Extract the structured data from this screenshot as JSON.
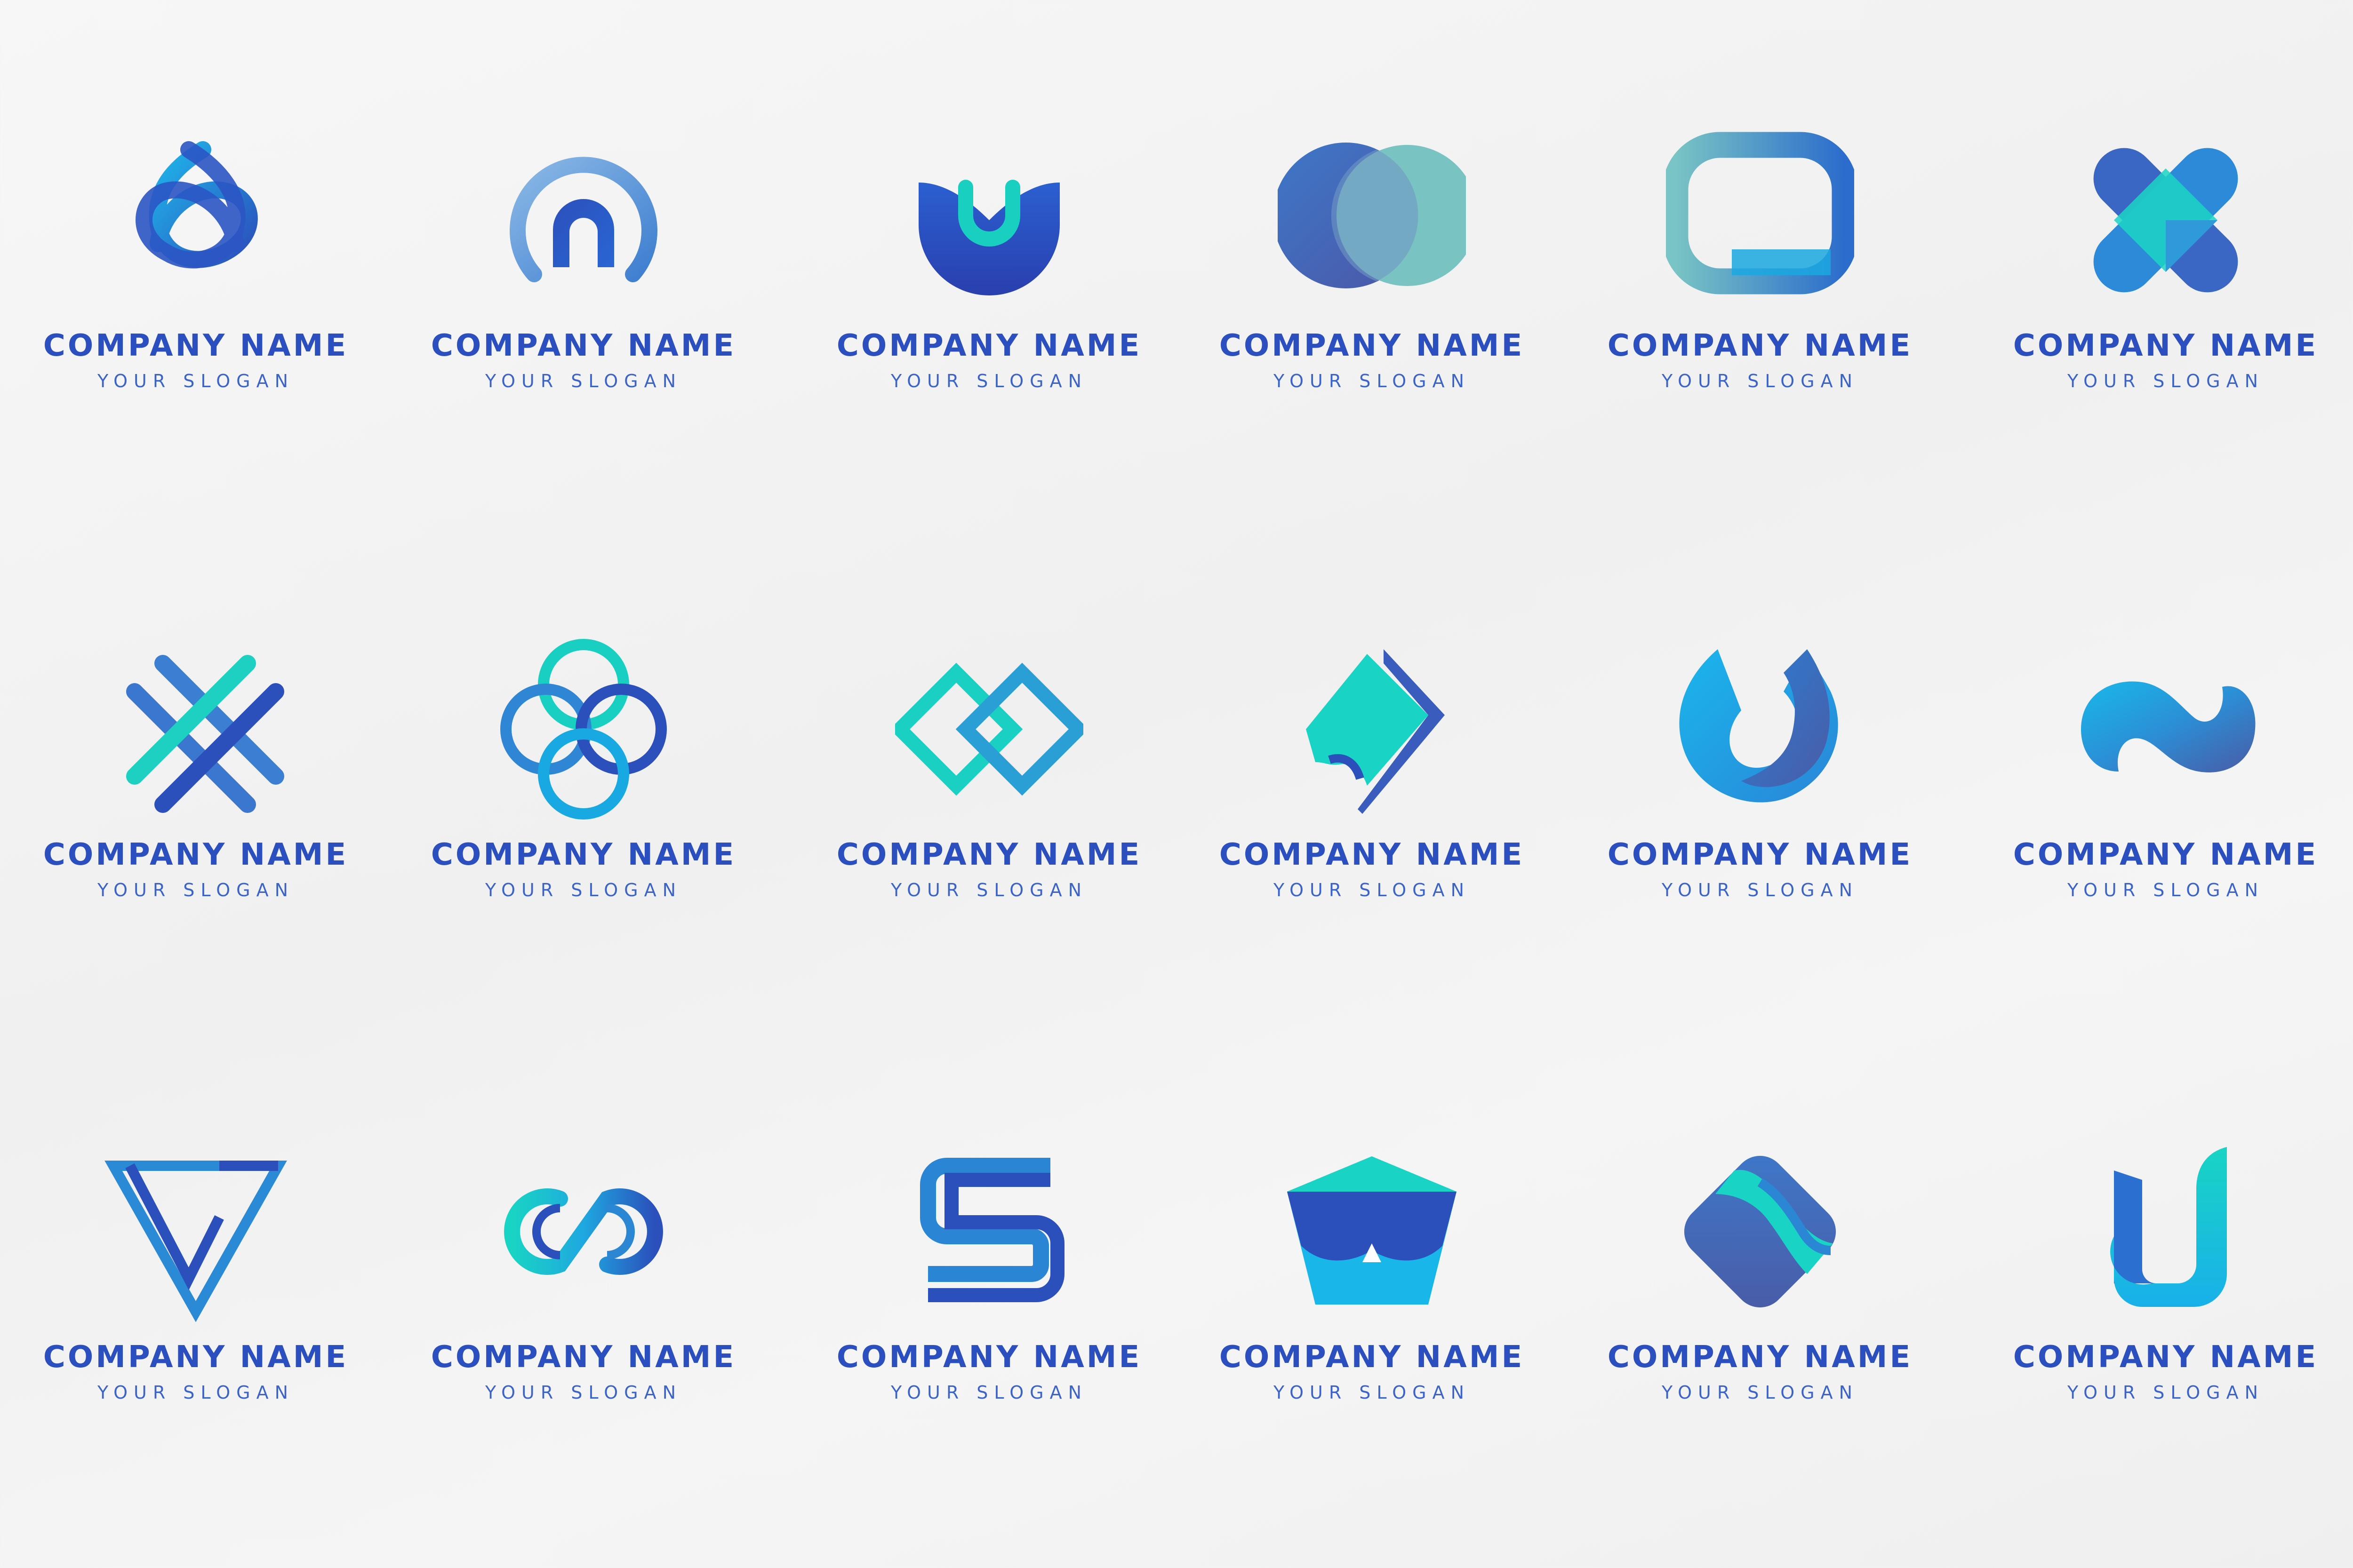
{
  "colors": {
    "name": "#2c4fc0",
    "slogan": "#3c64c8",
    "deep_blue": "#2a49b8",
    "mid_blue": "#2f77d0",
    "sky_blue": "#18b4e8",
    "teal": "#19d6c6",
    "slate": "#4a5ba6",
    "soft_teal": "#79c4c4"
  },
  "logos": [
    {
      "icon": "knot-drop-icon",
      "company_name": "COMPANY NAME",
      "slogan": "YOUR SLOGAN"
    },
    {
      "icon": "horseshoe-ring-icon",
      "company_name": "COMPANY NAME",
      "slogan": "YOUR SLOGAN"
    },
    {
      "icon": "tulip-cup-icon",
      "company_name": "COMPANY NAME",
      "slogan": "YOUR SLOGAN"
    },
    {
      "icon": "overlapping-circles-icon",
      "company_name": "COMPANY NAME",
      "slogan": "YOUR SLOGAN"
    },
    {
      "icon": "rounded-rectangle-ring-icon",
      "company_name": "COMPANY NAME",
      "slogan": "YOUR SLOGAN"
    },
    {
      "icon": "x-cross-icon",
      "company_name": "COMPANY NAME",
      "slogan": "YOUR SLOGAN"
    },
    {
      "icon": "hashtag-cross-icon",
      "company_name": "COMPANY NAME",
      "slogan": "YOUR SLOGAN"
    },
    {
      "icon": "interlocking-rings-icon",
      "company_name": "COMPANY NAME",
      "slogan": "YOUR SLOGAN"
    },
    {
      "icon": "linked-diamonds-icon",
      "company_name": "COMPANY NAME",
      "slogan": "YOUR SLOGAN"
    },
    {
      "icon": "folded-square-icon",
      "company_name": "COMPANY NAME",
      "slogan": "YOUR SLOGAN"
    },
    {
      "icon": "u-drop-icon",
      "company_name": "COMPANY NAME",
      "slogan": "YOUR SLOGAN"
    },
    {
      "icon": "wave-s-icon",
      "company_name": "COMPANY NAME",
      "slogan": "YOUR SLOGAN"
    },
    {
      "icon": "w-triangle-icon",
      "company_name": "COMPANY NAME",
      "slogan": "YOUR SLOGAN"
    },
    {
      "icon": "infinity-loop-icon",
      "company_name": "COMPANY NAME",
      "slogan": "YOUR SLOGAN"
    },
    {
      "icon": "letter-s-icon",
      "company_name": "COMPANY NAME",
      "slogan": "YOUR SLOGAN"
    },
    {
      "icon": "pentagon-icon",
      "company_name": "COMPANY NAME",
      "slogan": "YOUR SLOGAN"
    },
    {
      "icon": "rounded-diamond-icon",
      "company_name": "COMPANY NAME",
      "slogan": "YOUR SLOGAN"
    },
    {
      "icon": "letter-u-icon",
      "company_name": "COMPANY NAME",
      "slogan": "YOUR SLOGAN"
    }
  ]
}
